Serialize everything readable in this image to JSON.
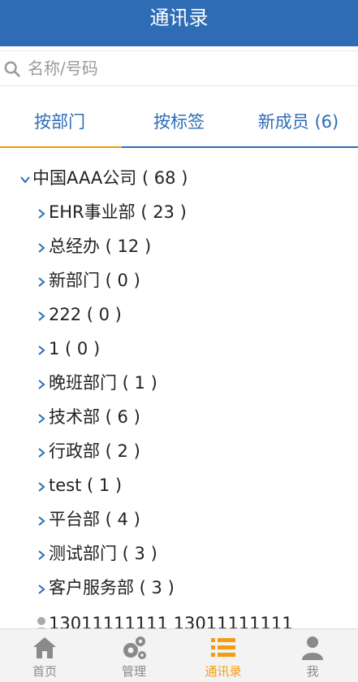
{
  "header": {
    "title": "通讯录"
  },
  "search": {
    "placeholder": "名称/号码"
  },
  "tabs": [
    {
      "label": "按部门",
      "active": true
    },
    {
      "label": "按标签"
    },
    {
      "label": "新成员 (6)"
    }
  ],
  "tree": {
    "root": {
      "label": "中国AAA公司 ( 68 )",
      "expanded": true
    },
    "departments": [
      {
        "label": "EHR事业部 ( 23 )"
      },
      {
        "label": "总经办 ( 12 )"
      },
      {
        "label": "新部门 ( 0 )"
      },
      {
        "label": "222 ( 0 )"
      },
      {
        "label": "1 ( 0 )"
      },
      {
        "label": "晚班部门 ( 1 )"
      },
      {
        "label": "技术部 ( 6 )"
      },
      {
        "label": "行政部 ( 2 )"
      },
      {
        "label": "test ( 1 )"
      },
      {
        "label": "平台部 ( 4 )"
      },
      {
        "label": "测试部门 ( 3 )"
      },
      {
        "label": "客户服务部 ( 3 )"
      }
    ],
    "member": {
      "label": "13011111111 13011111111"
    }
  },
  "tabbar": [
    {
      "label": "首页",
      "icon": "home-icon"
    },
    {
      "label": "管理",
      "icon": "gears-icon"
    },
    {
      "label": "通讯录",
      "icon": "list-icon",
      "active": true
    },
    {
      "label": "我",
      "icon": "user-icon"
    }
  ],
  "colors": {
    "primary": "#2e6cb5",
    "accent": "#f39c12",
    "tabbar_bg": "#f3f3f3",
    "muted": "#8a8a8a"
  }
}
